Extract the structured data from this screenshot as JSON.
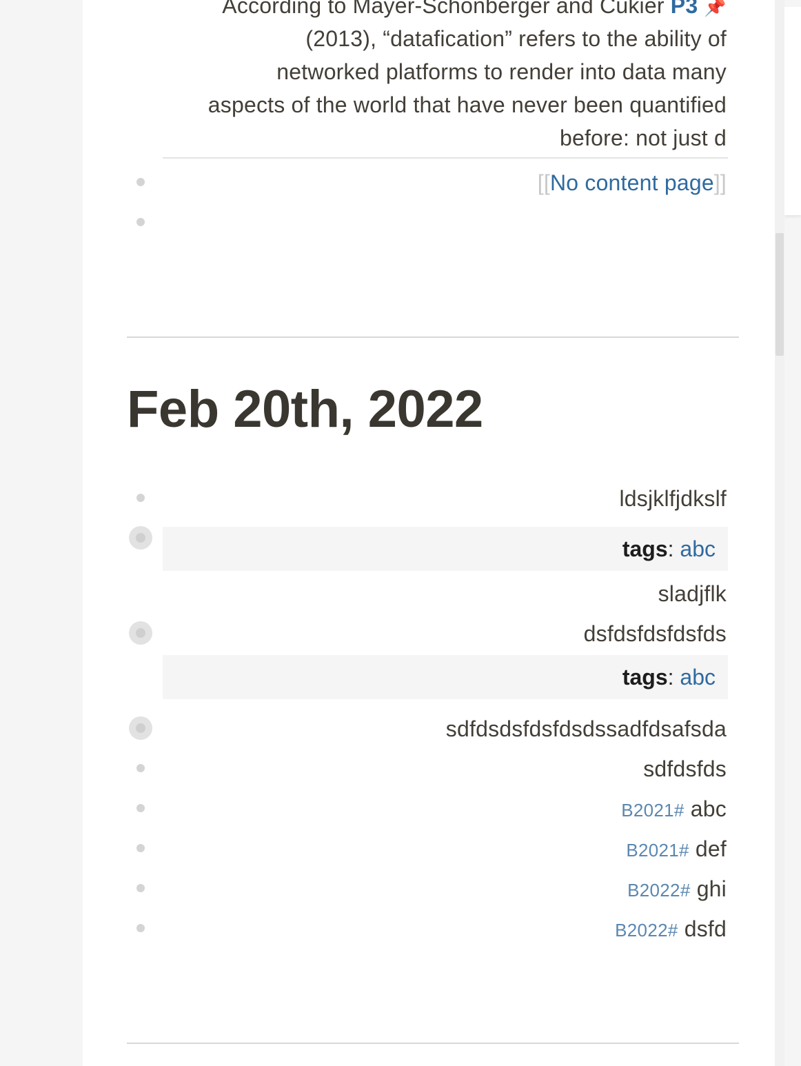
{
  "quote": {
    "line1_prefix": "According to Mayer-Schönberger and Cukier",
    "line1_ref": "P3",
    "line2": "(2013), “datafication” refers to the ability of",
    "line3": "networked platforms to render into data many",
    "line4": "aspects of the world that have never been quantified",
    "line5": "before: not just d"
  },
  "top_blocks": {
    "link_open": "[[",
    "link_text": "No content page",
    "link_close": "]]"
  },
  "journal": {
    "title": "Feb 20th, 2022"
  },
  "blocks": [
    {
      "text": "ldsjklfjdkslf"
    },
    {
      "prop_key": "tags",
      "prop_sep": ":",
      "prop_value": "abc",
      "text": "sladjflk"
    },
    {
      "text": "dsfdsfdsfdsfds",
      "prop_key": "tags",
      "prop_sep": ":",
      "prop_value": "abc"
    },
    {
      "text": "sdfdsdsfdsfdsdssadfdsafsda"
    },
    {
      "text": "sdfdsfds"
    },
    {
      "tag": "B2021#",
      "text": "abc"
    },
    {
      "tag": "B2021#",
      "text": "def"
    },
    {
      "tag": "B2022#",
      "text": "ghi"
    },
    {
      "tag": "B2022#",
      "text": "dsfd"
    }
  ],
  "colors": {
    "link": "#2f6a9f",
    "tag": "#5b87b0",
    "text": "#433f38",
    "property_bg": "#f5f5f5"
  },
  "icons": {
    "pin": "pushpin-icon",
    "bullet": "bullet-dot-icon",
    "collapsed_bullet": "collapsed-bullet-icon"
  }
}
